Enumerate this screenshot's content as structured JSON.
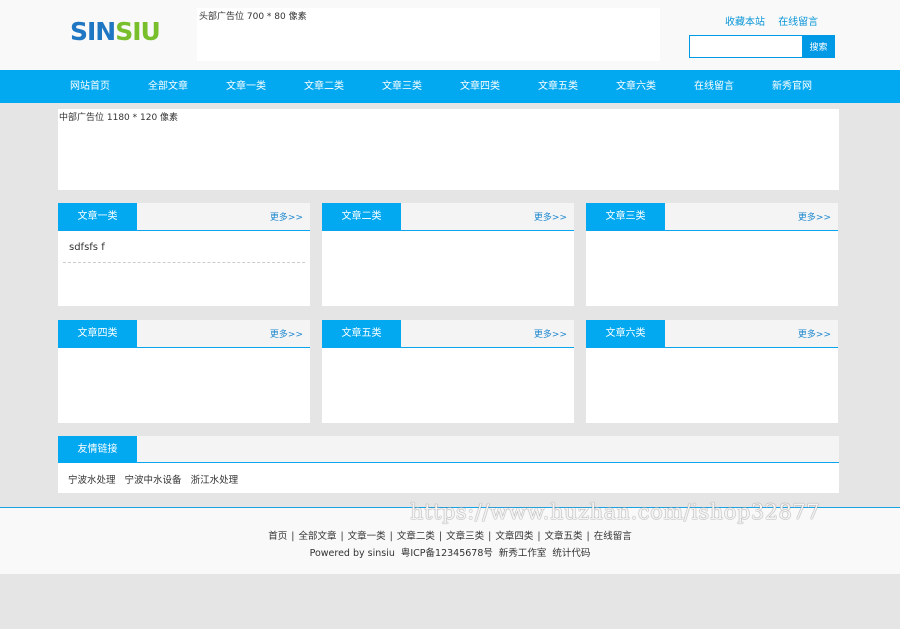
{
  "header": {
    "logo_part1": "SIN",
    "logo_part2": "SIU",
    "top_ad_text": "头部广告位 700 * 80 像素",
    "top_links": [
      "收藏本站",
      "在线留言"
    ],
    "search_button": "搜索",
    "search_value": ""
  },
  "nav": [
    "网站首页",
    "全部文章",
    "文章一类",
    "文章二类",
    "文章三类",
    "文章四类",
    "文章五类",
    "文章六类",
    "在线留言",
    "新秀官网"
  ],
  "mid_ad_text": "中部广告位 1180 * 120 像素",
  "boxes": [
    {
      "title": "文章一类",
      "more": "更多>>",
      "items": [
        "sdfsfs f"
      ]
    },
    {
      "title": "文章二类",
      "more": "更多>>",
      "items": []
    },
    {
      "title": "文章三类",
      "more": "更多>>",
      "items": []
    },
    {
      "title": "文章四类",
      "more": "更多>>",
      "items": []
    },
    {
      "title": "文章五类",
      "more": "更多>>",
      "items": []
    },
    {
      "title": "文章六类",
      "more": "更多>>",
      "items": []
    }
  ],
  "friend_links": {
    "title": "友情链接",
    "items": [
      "宁波水处理",
      "宁波中水设备",
      "浙江水处理"
    ]
  },
  "footer": {
    "nav": [
      "首页",
      "全部文章",
      "文章一类",
      "文章二类",
      "文章三类",
      "文章四类",
      "文章五类",
      "在线留言"
    ],
    "info": [
      "Powered by sinsiu",
      "粤ICP备12345678号",
      "新秀工作室",
      "统计代码"
    ]
  },
  "watermark": "https://www.huzhan.com/ishop32877",
  "colors": {
    "accent": "#02a9f1",
    "logo_blue": "#1f76c2",
    "logo_green": "#78bf2b"
  }
}
